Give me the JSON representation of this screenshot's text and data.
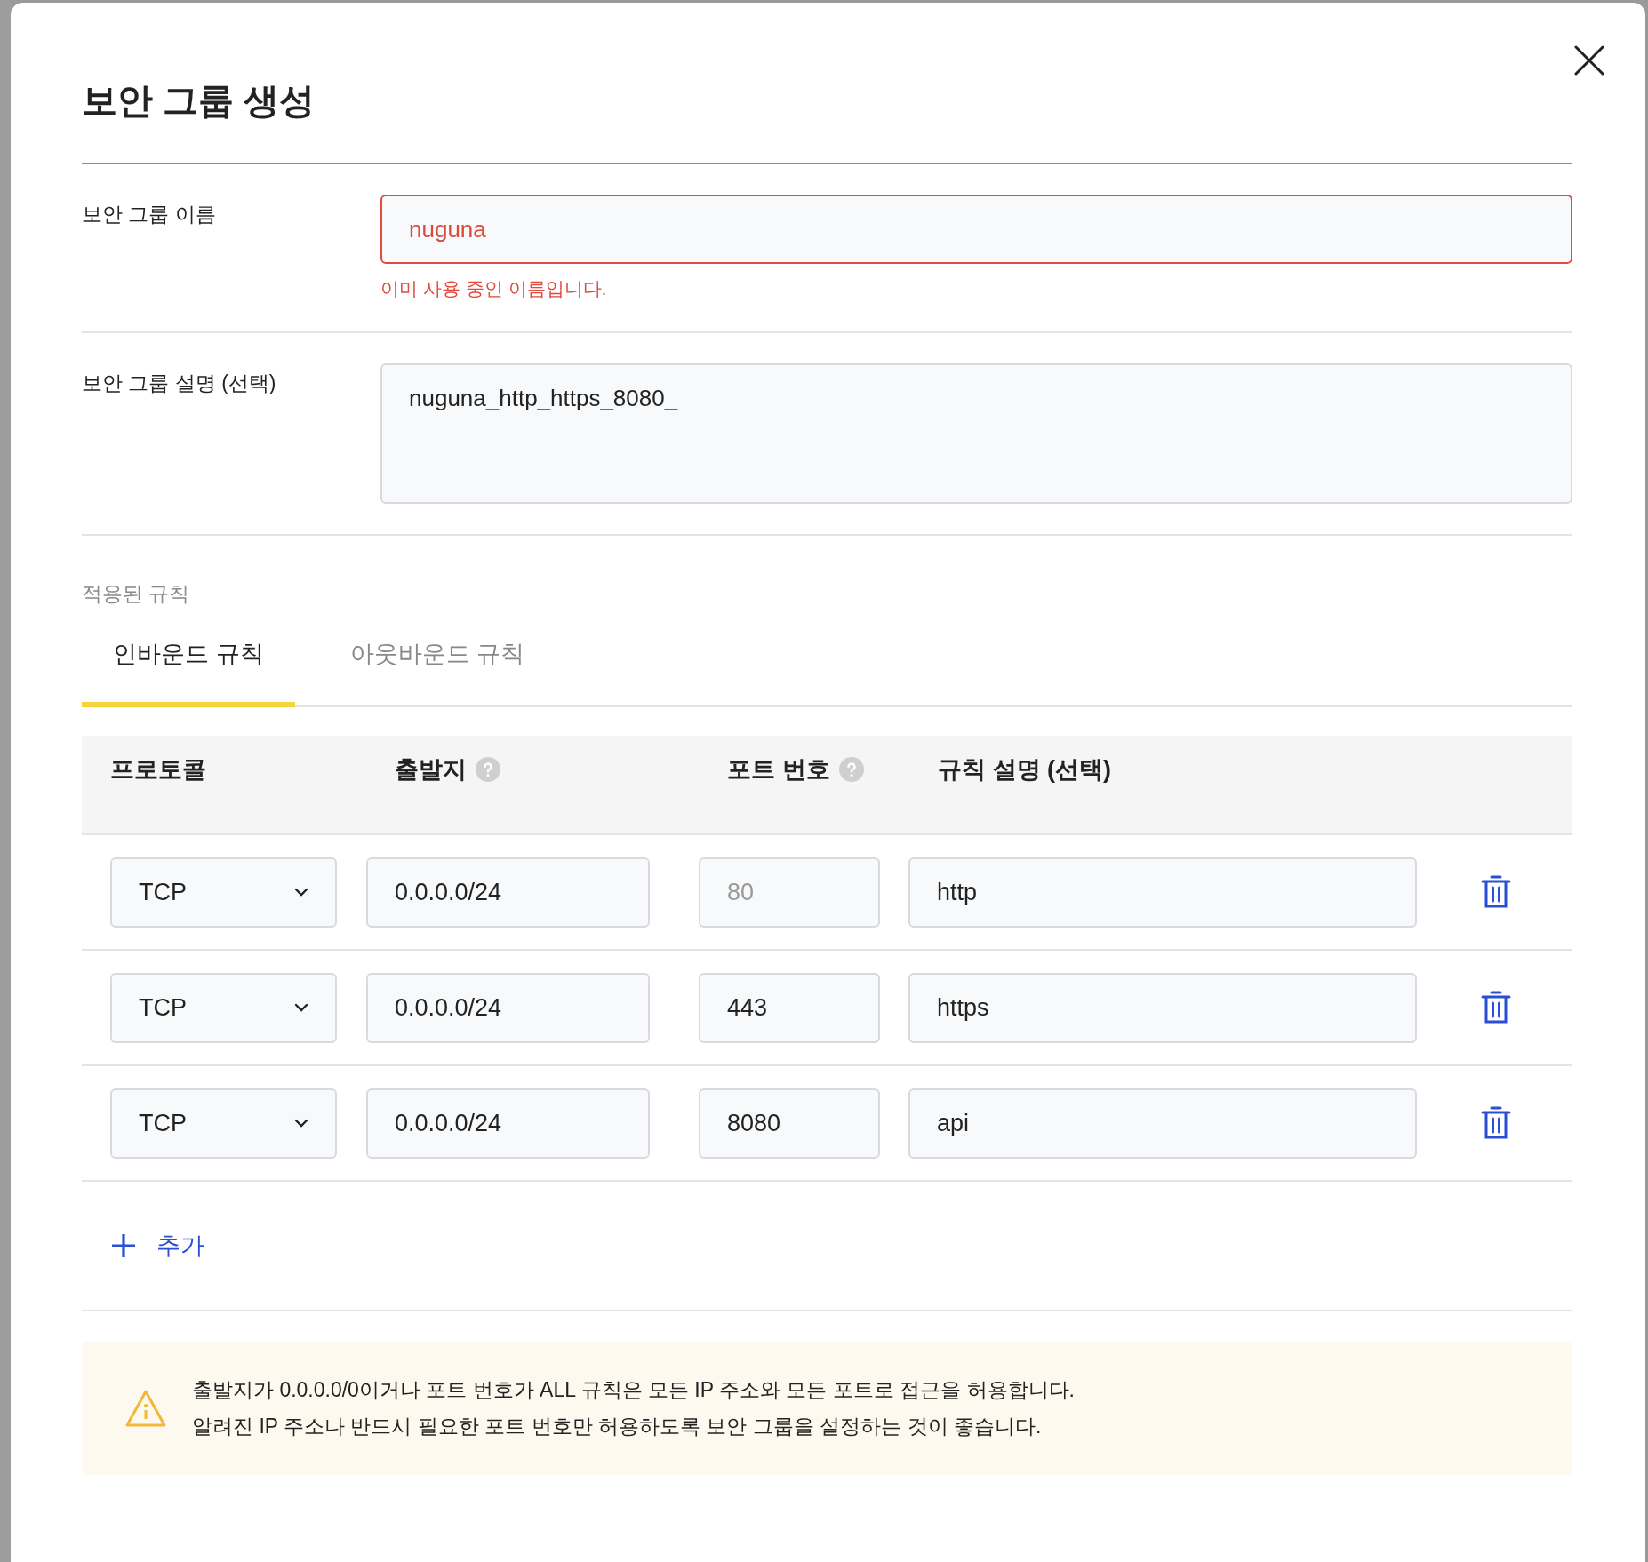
{
  "dialog": {
    "title": "보안 그룹 생성"
  },
  "name_field": {
    "label": "보안 그룹 이름",
    "value": "nuguna",
    "error": "이미 사용 중인 이름입니다."
  },
  "description_field": {
    "label": "보안 그룹 설명 (선택)",
    "value": "nuguna_http_https_8080_"
  },
  "rules_section": {
    "title": "적용된 규칙"
  },
  "tabs": [
    {
      "label": "인바운드 규칙",
      "selected": true
    },
    {
      "label": "아웃바운드 규칙",
      "selected": false
    }
  ],
  "table": {
    "columns": [
      {
        "label": "프로토콜",
        "help": false
      },
      {
        "label": "출발지",
        "help": true
      },
      {
        "label": "포트 번호",
        "help": true
      },
      {
        "label": "규칙 설명 (선택)",
        "help": false
      }
    ],
    "rows": [
      {
        "protocol": "TCP",
        "source": "0.0.0.0/24",
        "port": "80",
        "port_disabled": true,
        "description": "http"
      },
      {
        "protocol": "TCP",
        "source": "0.0.0.0/24",
        "port": "443",
        "port_disabled": false,
        "description": "https"
      },
      {
        "protocol": "TCP",
        "source": "0.0.0.0/24",
        "port": "8080",
        "port_disabled": false,
        "description": "api"
      }
    ]
  },
  "add_button": {
    "label": "추가"
  },
  "warning": {
    "lines": [
      "출발지가 0.0.0.0/0이거나 포트 번호가 ALL 규칙은 모든 IP 주소와 모든 포트로 접근을 허용합니다.",
      "알려진 IP 주소나 반드시 필요한 포트 번호만 허용하도록 보안 그룹을 설정하는 것이 좋습니다."
    ]
  }
}
